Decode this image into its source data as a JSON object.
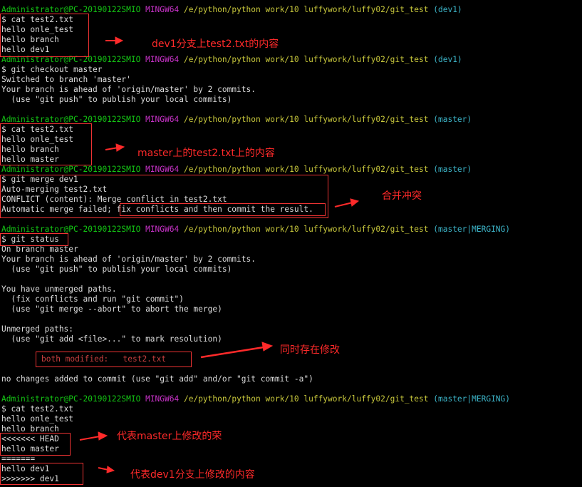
{
  "prompt": {
    "user": "Administrator@PC-20190122SMIO",
    "shell": "MINGW64",
    "path": "/e/python/python work/10 luffywork/luffy02/git_test"
  },
  "prompts": [
    {
      "branch": "(dev1)"
    },
    {
      "branch": "(dev1)"
    },
    {
      "branch": "(master)"
    },
    {
      "branch": "(master)"
    },
    {
      "branch": "(master|MERGING)"
    },
    {
      "branch": "(master|MERGING)"
    }
  ],
  "lines": {
    "cmd_cat1": "$ cat test2.txt",
    "out1_1": "hello onle_test",
    "out1_2": "hello branch",
    "out1_3": "hello dev1",
    "cmd_checkout": "$ git checkout master",
    "co_1": "Switched to branch 'master'",
    "co_2": "Your branch is ahead of 'origin/master' by 2 commits.",
    "co_3": "  (use \"git push\" to publish your local commits)",
    "cmd_cat2": "$ cat test2.txt",
    "out2_1": "hello onle_test",
    "out2_2": "hello branch",
    "out2_3": "hello master",
    "cmd_merge": "$ git merge dev1",
    "merge_1": "Auto-merging test2.txt",
    "merge_2": "CONFLICT (content): Merge conflict in test2.txt",
    "merge_3a": "Automatic merge failed; ",
    "merge_3b": "fix conflicts and then commit the result.",
    "cmd_status": "$ git status",
    "st_1": "On branch master",
    "st_2": "Your branch is ahead of 'origin/master' by 2 commits.",
    "st_3": "  (use \"git push\" to publish your local commits)",
    "st_4": "You have unmerged paths.",
    "st_5": "  (fix conflicts and run \"git commit\")",
    "st_6": "  (use \"git merge --abort\" to abort the merge)",
    "st_7": "Unmerged paths:",
    "st_8": "  (use \"git add <file>...\" to mark resolution)",
    "st_both": "both modified:   test2.txt",
    "st_9": "no changes added to commit (use \"git add\" and/or \"git commit -a\")",
    "cmd_cat3": "$ cat test2.txt",
    "out3_1": "hello onle_test",
    "out3_2": "hello branch",
    "out3_3": "<<<<<<< HEAD",
    "out3_4": "hello master",
    "out3_5": "=======",
    "out3_6": "hello dev1",
    "out3_7": ">>>>>>> dev1"
  },
  "annotations": {
    "a1": "dev1分支上test2.txt的内容",
    "a2": "master上的test2.txt上的内容",
    "a3": "合并冲突",
    "a4": "同时存在修改",
    "a5": "代表master上修改的荣",
    "a6": "代表dev1分支上修改的内容"
  },
  "colors": {
    "background": "#000000",
    "user_green": "#14c814",
    "shell_magenta": "#c832c8",
    "path_yellow": "#c8c83c",
    "branch_cyan": "#3cb4c8",
    "annotation_red": "#ff2a2a"
  }
}
